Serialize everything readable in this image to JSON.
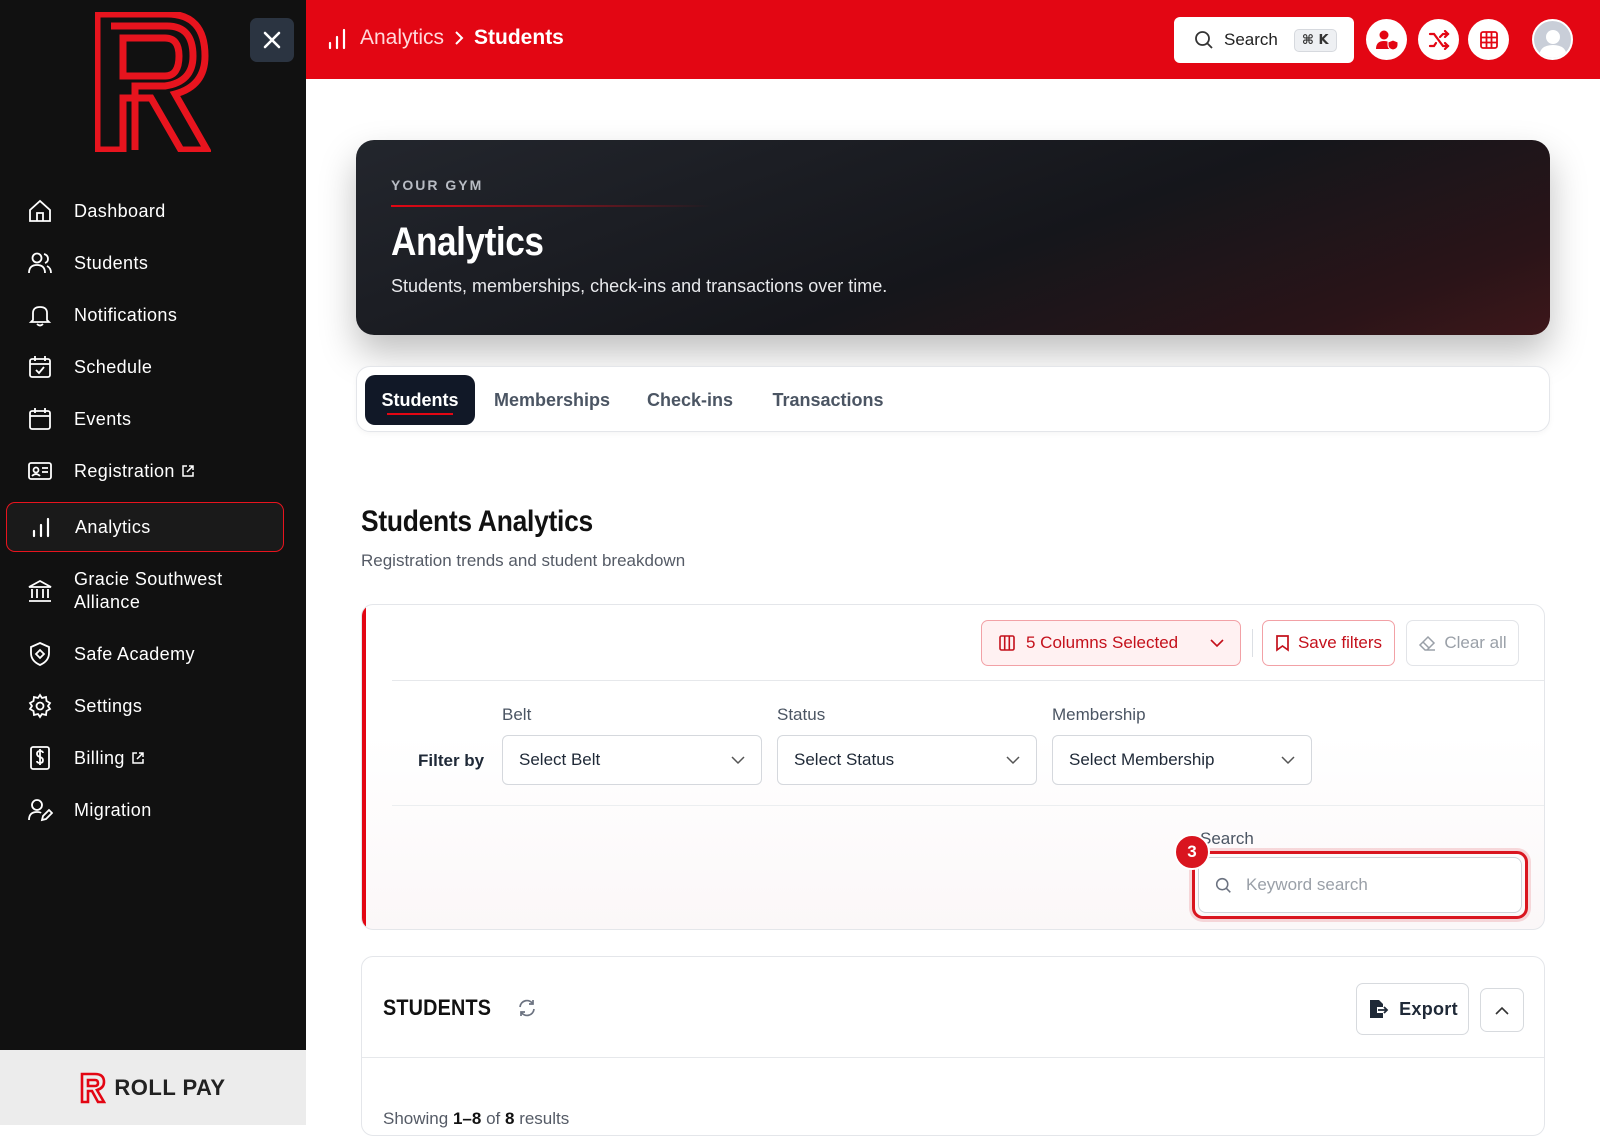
{
  "app": {
    "brand_footer": "ROLL PAY"
  },
  "colors": {
    "brand_red": "#e30613",
    "sidebar_bg": "#111111",
    "dark_nav": "#111827"
  },
  "sidebar": {
    "items": [
      {
        "label": "Dashboard",
        "icon": "home-icon"
      },
      {
        "label": "Students",
        "icon": "users-icon"
      },
      {
        "label": "Notifications",
        "icon": "bell-icon"
      },
      {
        "label": "Schedule",
        "icon": "calendar-check-icon"
      },
      {
        "label": "Events",
        "icon": "calendar-icon"
      },
      {
        "label": "Registration",
        "icon": "id-card-icon",
        "external": true
      },
      {
        "label": "Analytics",
        "icon": "bar-chart-icon",
        "active": true
      },
      {
        "label": "Gracie Southwest Alliance",
        "icon": "bank-icon"
      },
      {
        "label": "Safe Academy",
        "icon": "shield-icon"
      },
      {
        "label": "Settings",
        "icon": "gear-icon"
      },
      {
        "label": "Billing",
        "icon": "dollar-doc-icon",
        "external": true
      },
      {
        "label": "Migration",
        "icon": "user-edit-icon"
      }
    ]
  },
  "topbar": {
    "breadcrumb": {
      "parent": "Analytics",
      "current": "Students"
    },
    "search": {
      "label": "Search",
      "shortcut": "⌘ K"
    }
  },
  "hero": {
    "eyebrow": "YOUR GYM",
    "title": "Analytics",
    "subtitle": "Students, memberships, check-ins and transactions over time."
  },
  "tabs": [
    {
      "label": "Students",
      "active": true
    },
    {
      "label": "Memberships"
    },
    {
      "label": "Check-ins"
    },
    {
      "label": "Transactions"
    }
  ],
  "section": {
    "title": "Students Analytics",
    "subtitle": "Registration trends and student breakdown"
  },
  "filters": {
    "columns_button": "5 Columns Selected",
    "save_button": "Save filters",
    "clear_button": "Clear all",
    "filter_by": "Filter by",
    "belt": {
      "label": "Belt",
      "value": "Select Belt"
    },
    "status": {
      "label": "Status",
      "value": "Select Status"
    },
    "membership": {
      "label": "Membership",
      "value": "Select Membership"
    },
    "search": {
      "label": "Search",
      "placeholder": "Keyword search"
    },
    "step_badge": "3"
  },
  "students_panel": {
    "title": "STUDENTS",
    "export": "Export",
    "showing": {
      "prefix": "Showing",
      "range": "1–8",
      "of": "of",
      "total": "8",
      "suffix": "results"
    }
  }
}
